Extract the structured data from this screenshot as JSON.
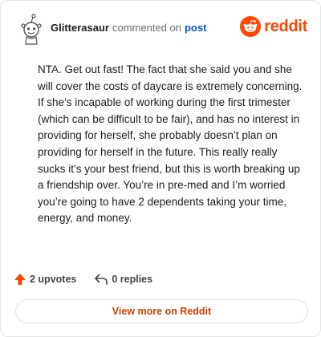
{
  "header": {
    "username": "Glitterasaur",
    "commented_on": "commented on",
    "post_link": "post",
    "brand_wordmark": "reddit"
  },
  "comment": {
    "text": "NTA. Get out fast! The fact that she said you and she will cover the costs of daycare is extremely concerning. If she’s incapable of working during the first trimester (which can be difficult to be fair), and has no interest in providing for herself, she probably doesn’t plan on providing for herself in the future. This really really sucks it’s your best friend, but this is worth breaking up a friendship over. You’re in pre-med and I’m worried you’re going to have 2 dependents taking your time, energy, and money."
  },
  "actions": {
    "upvotes_label": "2 upvotes",
    "replies_label": "0 replies"
  },
  "footer": {
    "view_more_label": "View more on Reddit"
  },
  "icons": {
    "avatar": "snoo-avatar-icon",
    "brand": "reddit-logo-icon",
    "upvote": "upvote-arrow-icon",
    "reply": "reply-arrow-icon"
  },
  "colors": {
    "brand_orange": "#ff4500",
    "link_blue": "#0a58ca",
    "view_more_text": "#d93a00",
    "upvote_arrow": "#ff4500"
  }
}
